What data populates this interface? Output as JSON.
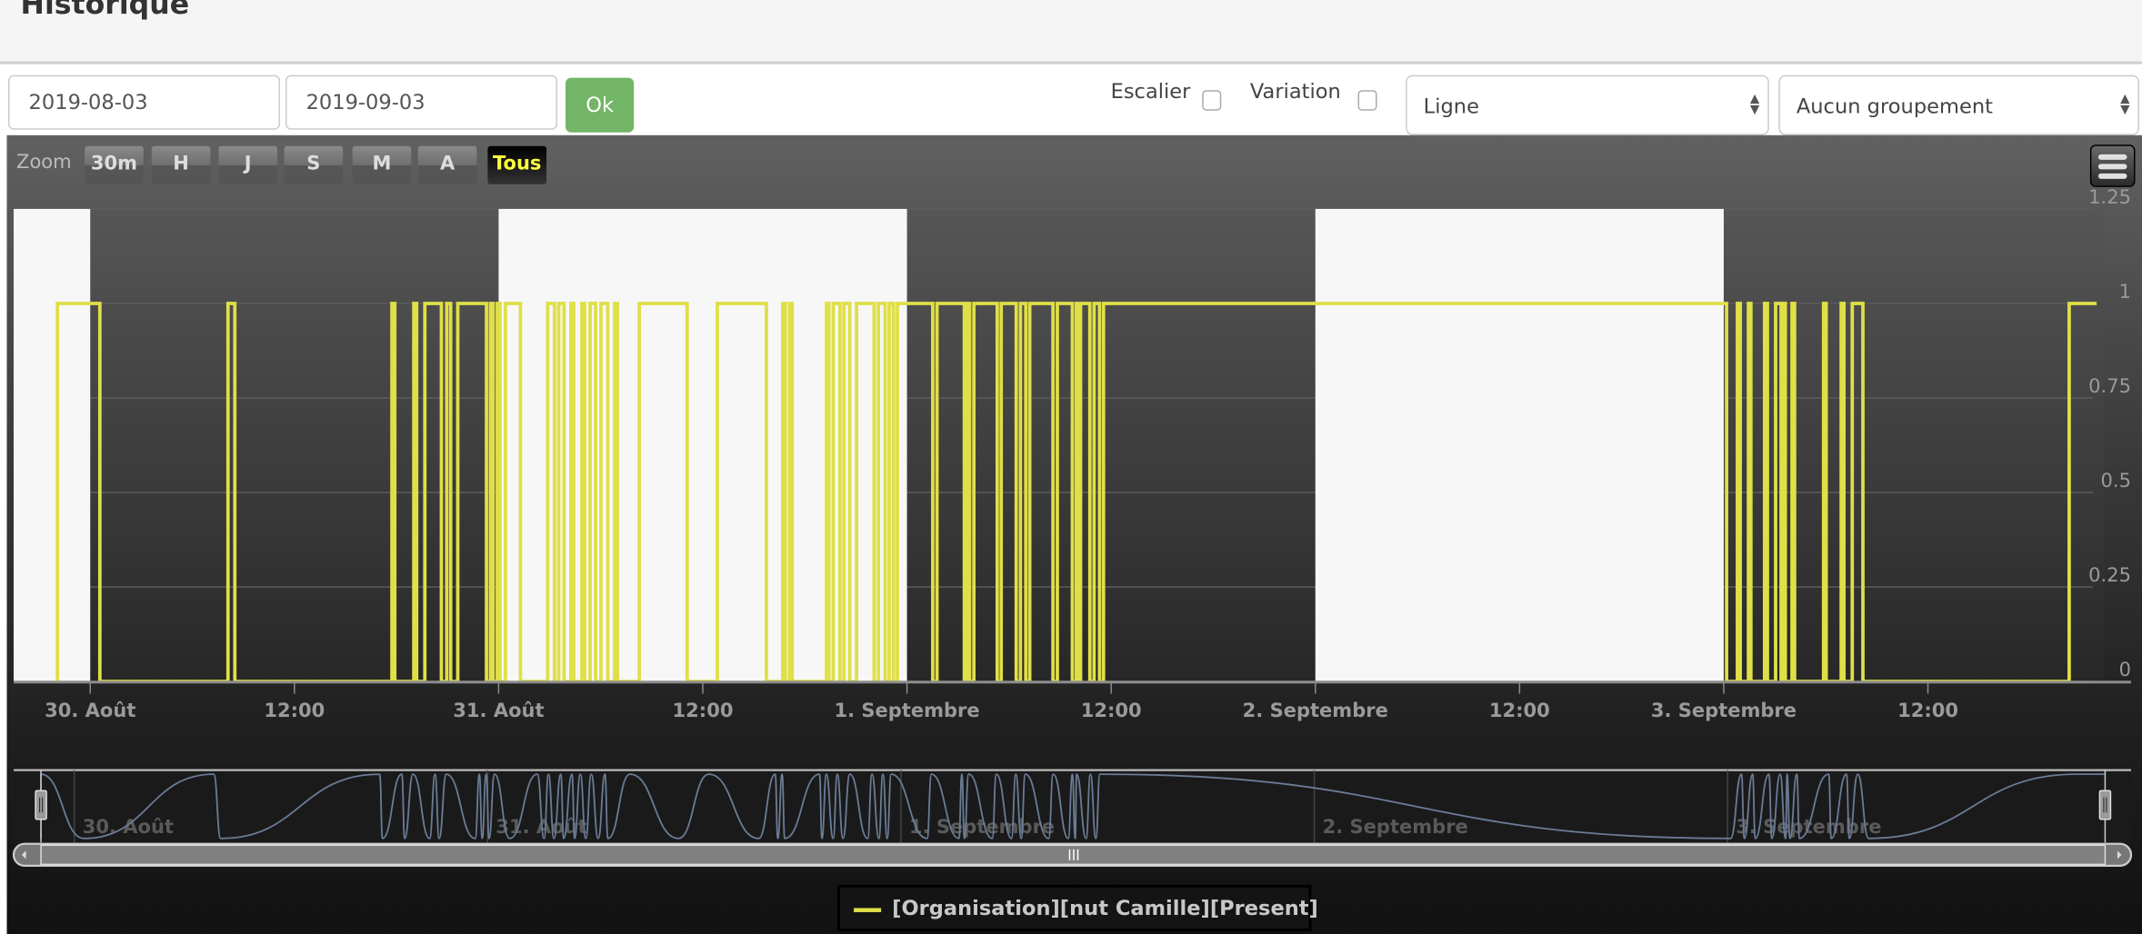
{
  "header": {
    "title": "Historique"
  },
  "controls": {
    "start_date": "2019-08-03",
    "end_date": "2019-09-03",
    "ok_label": "Ok",
    "escalier_label": "Escalier",
    "escalier_checked": false,
    "variation_label": "Variation",
    "variation_checked": false,
    "chart_type_select": "Ligne",
    "grouping_select": "Aucun groupement"
  },
  "range_selector": {
    "label": "Zoom",
    "buttons": [
      "30m",
      "H",
      "J",
      "S",
      "M",
      "A",
      "Tous"
    ],
    "selected": "Tous"
  },
  "menu_icon": "hamburger-menu-icon",
  "chart_data": {
    "type": "line",
    "step": true,
    "ylim": [
      0,
      1.25
    ],
    "yticks": [
      "0",
      "0.25",
      "0.5",
      "0.75",
      "1",
      "1.25"
    ],
    "xlim": [
      "2019-08-29 19:30",
      "2019-09-03 22:20"
    ],
    "xticks": [
      {
        "t": "2019-08-30 00:00",
        "label": "30. Août"
      },
      {
        "t": "2019-08-30 12:00",
        "label": "12:00"
      },
      {
        "t": "2019-08-31 00:00",
        "label": "31. Août"
      },
      {
        "t": "2019-08-31 12:00",
        "label": "12:00"
      },
      {
        "t": "2019-09-01 00:00",
        "label": "1. Septembre"
      },
      {
        "t": "2019-09-01 12:00",
        "label": "12:00"
      },
      {
        "t": "2019-09-02 00:00",
        "label": "2. Septembre"
      },
      {
        "t": "2019-09-02 12:00",
        "label": "12:00"
      },
      {
        "t": "2019-09-03 00:00",
        "label": "3. Septembre"
      },
      {
        "t": "2019-09-03 12:00",
        "label": "12:00"
      }
    ],
    "plot_bands": [
      {
        "from": "2019-08-29 19:30",
        "to": "2019-08-30 00:00",
        "color": "#f7f7f7"
      },
      {
        "from": "2019-08-31 00:00",
        "to": "2019-09-01 00:00",
        "color": "#f7f7f7"
      },
      {
        "from": "2019-09-02 00:00",
        "to": "2019-09-03 00:00",
        "color": "#f7f7f7"
      }
    ],
    "series": [
      {
        "name": "[Organisation][nut Camille][Present]",
        "color": "#dfdf48",
        "navigator_color": "#6a7c95",
        "on_intervals": [
          [
            "2019-08-29 22:04",
            "2019-08-30 00:34"
          ],
          [
            "2019-08-30 08:06",
            "2019-08-30 08:30"
          ],
          [
            "2019-08-30 17:44",
            "2019-08-30 17:54"
          ],
          [
            "2019-08-30 19:01",
            "2019-08-30 19:11"
          ],
          [
            "2019-08-30 19:40",
            "2019-08-30 20:38"
          ],
          [
            "2019-08-30 20:57",
            "2019-08-30 21:11"
          ],
          [
            "2019-08-30 21:36",
            "2019-08-30 23:17"
          ],
          [
            "2019-08-30 23:31",
            "2019-08-30 23:41"
          ],
          [
            "2019-08-30 23:55",
            "2019-08-31 00:05"
          ],
          [
            "2019-08-31 00:24",
            "2019-08-31 01:17"
          ],
          [
            "2019-08-31 02:53",
            "2019-08-31 03:17"
          ],
          [
            "2019-08-31 03:32",
            "2019-08-31 03:51"
          ],
          [
            "2019-08-31 04:15",
            "2019-08-31 04:25"
          ],
          [
            "2019-08-31 04:54",
            "2019-08-31 05:03"
          ],
          [
            "2019-08-31 05:23",
            "2019-08-31 05:42"
          ],
          [
            "2019-08-31 06:01",
            "2019-08-31 06:25"
          ],
          [
            "2019-08-31 06:49",
            "2019-08-31 06:59"
          ],
          [
            "2019-08-31 08:16",
            "2019-08-31 11:05"
          ],
          [
            "2019-08-31 12:51",
            "2019-08-31 15:44"
          ],
          [
            "2019-08-31 16:42",
            "2019-08-31 16:51"
          ],
          [
            "2019-08-31 17:06",
            "2019-08-31 17:15"
          ],
          [
            "2019-08-31 19:16",
            "2019-08-31 19:25"
          ],
          [
            "2019-08-31 19:40",
            "2019-08-31 20:04"
          ],
          [
            "2019-08-31 20:18",
            "2019-08-31 20:38"
          ],
          [
            "2019-08-31 21:02",
            "2019-08-31 22:04"
          ],
          [
            "2019-08-31 22:19",
            "2019-08-31 22:43"
          ],
          [
            "2019-08-31 22:57",
            "2019-08-31 23:12"
          ],
          [
            "2019-08-31 23:26",
            "2019-09-01 01:31"
          ],
          [
            "2019-09-01 01:46",
            "2019-09-01 03:22"
          ],
          [
            "2019-09-01 03:32",
            "2019-09-01 03:41"
          ],
          [
            "2019-09-01 03:56",
            "2019-09-01 05:18"
          ],
          [
            "2019-09-01 05:32",
            "2019-09-01 06:25"
          ],
          [
            "2019-09-01 06:40",
            "2019-09-01 06:59"
          ],
          [
            "2019-09-01 07:13",
            "2019-09-01 08:35"
          ],
          [
            "2019-09-01 08:50",
            "2019-09-01 09:43"
          ],
          [
            "2019-09-01 09:57",
            "2019-09-01 10:07"
          ],
          [
            "2019-09-01 10:12",
            "2019-09-01 10:45"
          ],
          [
            "2019-09-01 11:00",
            "2019-09-01 11:19"
          ],
          [
            "2019-09-01 11:33",
            "2019-09-03 00:10"
          ],
          [
            "2019-09-03 00:48",
            "2019-09-03 00:58"
          ],
          [
            "2019-09-03 01:27",
            "2019-09-03 01:36"
          ],
          [
            "2019-09-03 02:24",
            "2019-09-03 02:34"
          ],
          [
            "2019-09-03 03:03",
            "2019-09-03 03:22"
          ],
          [
            "2019-09-03 03:27",
            "2019-09-03 03:37"
          ],
          [
            "2019-09-03 04:01",
            "2019-09-03 04:10"
          ],
          [
            "2019-09-03 05:52",
            "2019-09-03 06:01"
          ],
          [
            "2019-09-03 06:54",
            "2019-09-03 07:04"
          ],
          [
            "2019-09-03 07:33",
            "2019-09-03 08:11"
          ],
          [
            "2019-09-03 20:18",
            "2019-09-03 21:55"
          ]
        ]
      }
    ],
    "navigator": {
      "xticks": [
        {
          "t": "2019-08-30 00:00",
          "label": "30. Août"
        },
        {
          "t": "2019-08-31 00:00",
          "label": "31. Août"
        },
        {
          "t": "2019-09-01 00:00",
          "label": "1. Septembre"
        },
        {
          "t": "2019-09-02 00:00",
          "label": "2. Septembre"
        },
        {
          "t": "2019-09-03 00:00",
          "label": "3. Septembre"
        }
      ]
    },
    "legend": {
      "position": "bottom-center"
    }
  }
}
